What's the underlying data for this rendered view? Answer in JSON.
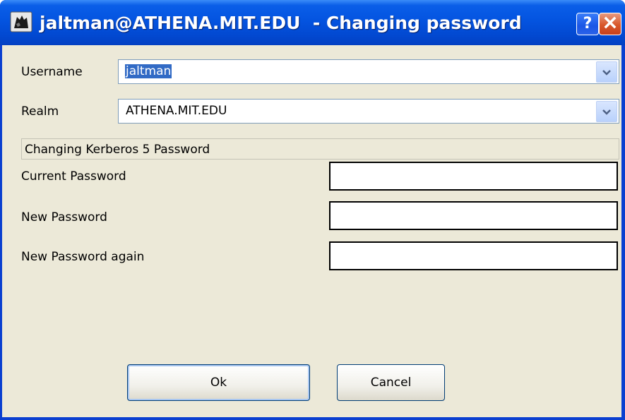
{
  "window": {
    "title": "jaltman@ATHENA.MIT.EDU  - Changing password",
    "help_label": "?",
    "close_label": "✕",
    "app_icon": "kerberos-app-icon"
  },
  "form": {
    "username_label": "Username",
    "username_value": "jaltman",
    "realm_label": "Realm",
    "realm_value": "ATHENA.MIT.EDU",
    "section_title": "Changing Kerberos 5 Password",
    "current_password_label": "Current Password",
    "new_password_label": "New Password",
    "new_password_again_label": "New Password again",
    "current_password_value": "",
    "new_password_value": "",
    "new_password_again_value": ""
  },
  "buttons": {
    "ok_label": "Ok",
    "cancel_label": "Cancel"
  },
  "colors": {
    "titlebar": "#0454e0",
    "dialog_bg": "#ece9d8",
    "selection": "#316ac5",
    "close_button": "#d8572a"
  }
}
